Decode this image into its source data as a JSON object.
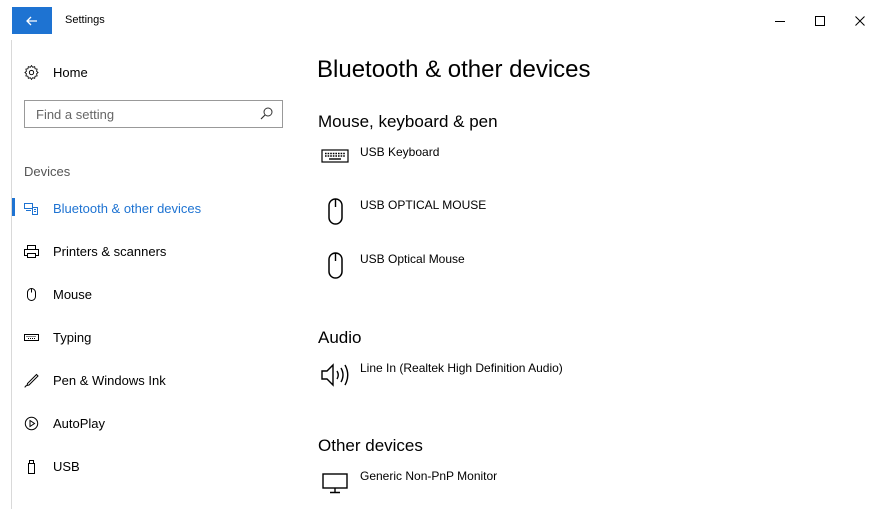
{
  "window": {
    "title": "Settings"
  },
  "sidebar": {
    "home_label": "Home",
    "search_placeholder": "Find a setting",
    "group_label": "Devices",
    "items": [
      {
        "label": "Bluetooth & other devices",
        "icon": "bluetooth-devices-icon",
        "active": true
      },
      {
        "label": "Printers & scanners",
        "icon": "printer-icon"
      },
      {
        "label": "Mouse",
        "icon": "mouse-icon"
      },
      {
        "label": "Typing",
        "icon": "keyboard-icon"
      },
      {
        "label": "Pen & Windows Ink",
        "icon": "pen-icon"
      },
      {
        "label": "AutoPlay",
        "icon": "autoplay-icon"
      },
      {
        "label": "USB",
        "icon": "usb-icon"
      }
    ]
  },
  "main": {
    "title": "Bluetooth & other devices",
    "sections": [
      {
        "title": "Mouse, keyboard & pen",
        "devices": [
          {
            "name": "USB Keyboard",
            "icon": "keyboard-icon"
          },
          {
            "name": "USB OPTICAL MOUSE",
            "icon": "mouse-icon"
          },
          {
            "name": "USB Optical Mouse",
            "icon": "mouse-icon"
          }
        ]
      },
      {
        "title": "Audio",
        "devices": [
          {
            "name": "Line In (Realtek High Definition Audio)",
            "icon": "speaker-icon"
          }
        ]
      },
      {
        "title": "Other devices",
        "devices": [
          {
            "name": "Generic Non-PnP Monitor",
            "icon": "monitor-icon"
          }
        ]
      }
    ]
  },
  "colors": {
    "accent": "#1e73d2",
    "text": "#000000",
    "muted": "#555555"
  }
}
